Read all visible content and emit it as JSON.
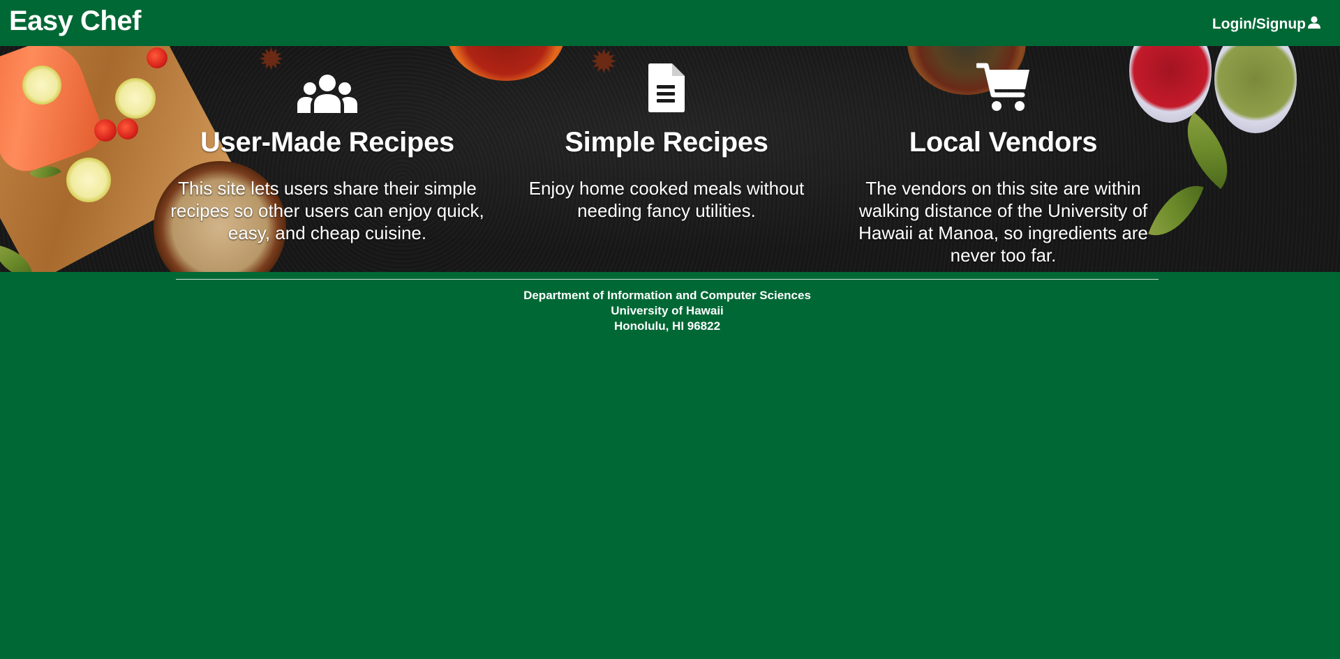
{
  "navbar": {
    "brand": "Easy Chef",
    "login_label": "Login/Signup",
    "login_icon": "user-icon"
  },
  "features": [
    {
      "icon": "users-icon",
      "title": "User-Made Recipes",
      "description": "This site lets users share their simple recipes so other users can enjoy quick, easy, and cheap cuisine."
    },
    {
      "icon": "document-icon",
      "title": "Simple Recipes",
      "description": "Enjoy home cooked meals without needing fancy utilities."
    },
    {
      "icon": "shopping-cart-icon",
      "title": "Local Vendors",
      "description": "The vendors on this site are within walking distance of the University of Hawaii at Manoa, so ingredients are never too far."
    }
  ],
  "footer": {
    "line1": "Department of Information and Computer Sciences",
    "line2": "University of Hawaii",
    "line3": "Honolulu, HI 96822"
  },
  "colors": {
    "background": "#006835",
    "text": "#ffffff",
    "hero_background": "#171717"
  }
}
